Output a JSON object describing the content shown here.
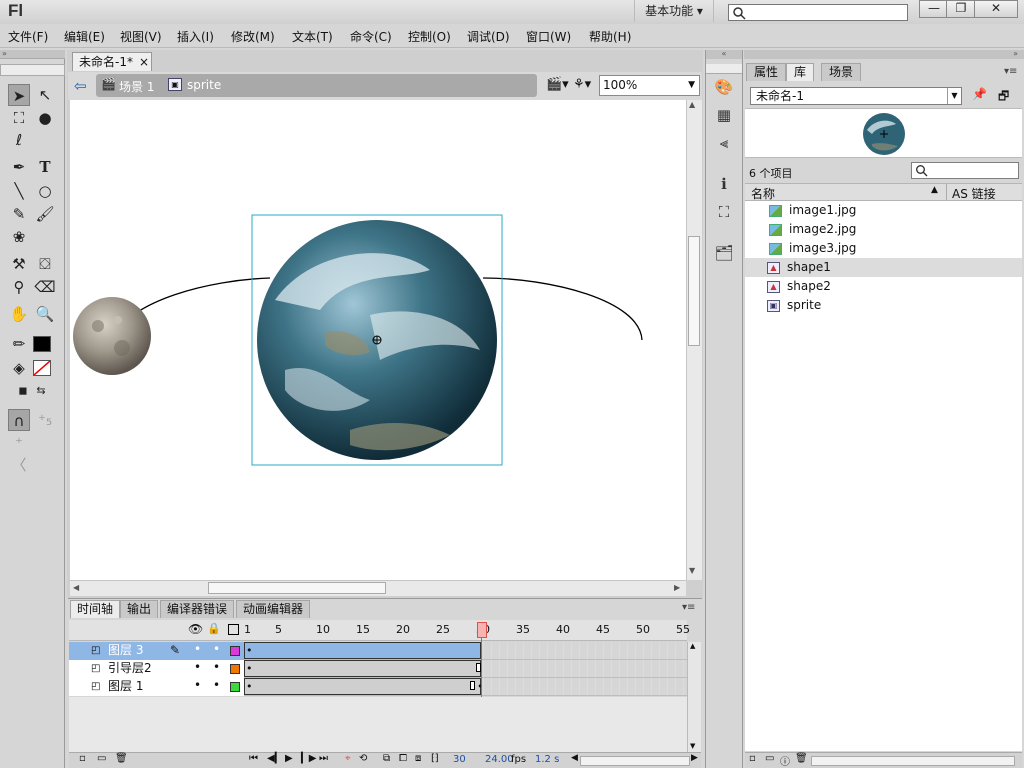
{
  "app": {
    "logo": "Fl",
    "workspace": "基本功能 ▾"
  },
  "window_controls": {
    "minimize": "—",
    "restore": "❐",
    "close": "✕"
  },
  "menu": [
    "文件(F)",
    "编辑(E)",
    "视图(V)",
    "插入(I)",
    "修改(M)",
    "文本(T)",
    "命令(C)",
    "控制(O)",
    "调试(D)",
    "窗口(W)",
    "帮助(H)"
  ],
  "document": {
    "tab_title": "未命名-1*",
    "tab_close": "×",
    "breadcrumb_scene": "场景 1",
    "breadcrumb_symbol": "sprite",
    "zoom": "100%"
  },
  "timeline": {
    "tabs": [
      "时间轴",
      "输出",
      "编译器错误",
      "动画编辑器"
    ],
    "frame_numbers": [
      "1",
      "5",
      "10",
      "15",
      "20",
      "25",
      "30",
      "35",
      "40",
      "45",
      "50",
      "55"
    ],
    "layers": [
      {
        "name": "图层 3",
        "color": "#d93ad9",
        "selected": true
      },
      {
        "name": "引导层2",
        "color": "#f07800",
        "selected": false
      },
      {
        "name": "图层 1",
        "color": "#3cd83c",
        "selected": false
      }
    ],
    "status": {
      "frame": "30",
      "fps": "24.00",
      "fps_unit": "fps",
      "time": "1.2 s"
    }
  },
  "library": {
    "tabs": [
      "属性",
      "库",
      "场景"
    ],
    "doc_name": "未命名-1",
    "count": "6 个项目",
    "col_name": "名称",
    "col_linkage": "AS 链接",
    "items": [
      {
        "name": "image1.jpg",
        "type": "bitmap"
      },
      {
        "name": "image2.jpg",
        "type": "bitmap"
      },
      {
        "name": "image3.jpg",
        "type": "bitmap"
      },
      {
        "name": "shape1",
        "type": "graphic"
      },
      {
        "name": "shape2",
        "type": "graphic"
      },
      {
        "name": "sprite",
        "type": "movieclip"
      }
    ]
  },
  "colors": {
    "accent_selected_row": "#8fb7e6",
    "playhead": "#e0504c",
    "stage_bg": "#ffffff"
  }
}
